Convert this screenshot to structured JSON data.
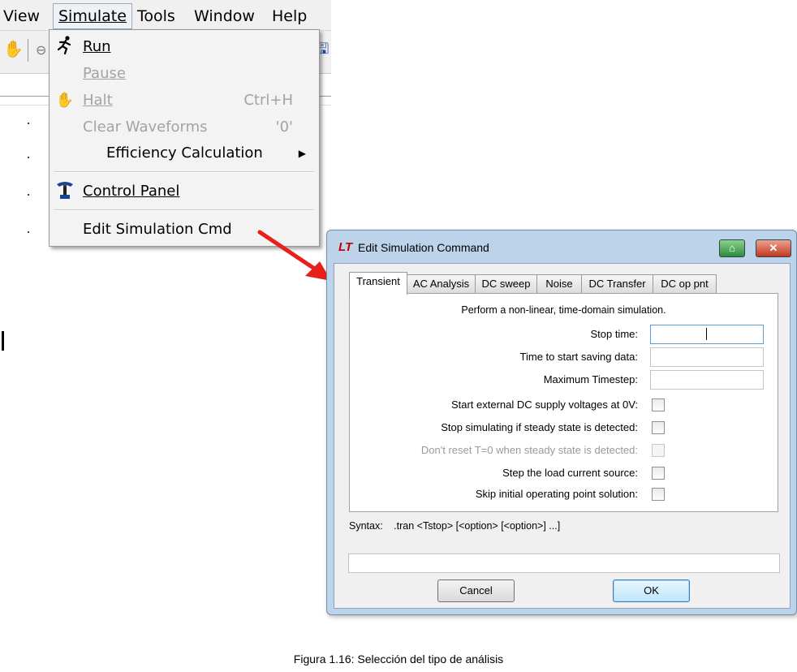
{
  "menubar": {
    "items": [
      {
        "label": "View"
      },
      {
        "label": "Simulate"
      },
      {
        "label": "Tools"
      },
      {
        "label": "Window"
      },
      {
        "label": "Help"
      }
    ]
  },
  "simulate_menu": {
    "run": {
      "label": "Run",
      "icon": "running-man-icon"
    },
    "pause": {
      "label": "Pause",
      "disabled": true
    },
    "halt": {
      "label": "Halt",
      "shortcut": "Ctrl+H",
      "icon": "hand-icon",
      "disabled": true
    },
    "clear_waveforms": {
      "label": "Clear Waveforms",
      "shortcut": "'0'",
      "disabled": true
    },
    "efficiency": {
      "label": "Efficiency Calculation",
      "submenu": true
    },
    "control_panel": {
      "label": "Control Panel",
      "icon": "control-panel-icon"
    },
    "edit_sim_cmd": {
      "label": "Edit Simulation Cmd"
    }
  },
  "dialog": {
    "logo": "LT",
    "title": "Edit Simulation Command",
    "tabs": [
      {
        "label": "Transient",
        "active": true
      },
      {
        "label": "AC Analysis"
      },
      {
        "label": "DC sweep"
      },
      {
        "label": "Noise"
      },
      {
        "label": "DC Transfer"
      },
      {
        "label": "DC op pnt"
      }
    ],
    "description": "Perform a non-linear, time-domain simulation.",
    "fields": {
      "stop_time": {
        "label": "Stop time:",
        "value": ""
      },
      "start_saving": {
        "label": "Time to start saving data:",
        "value": ""
      },
      "max_timestep": {
        "label": "Maximum Timestep:",
        "value": ""
      }
    },
    "checkboxes": {
      "start_dc_0v": {
        "label": "Start external DC supply voltages at 0V:",
        "checked": false
      },
      "stop_steady": {
        "label": "Stop simulating if steady state is detected:",
        "checked": false
      },
      "dont_reset": {
        "label": "Don't reset T=0 when steady state is detected:",
        "checked": false,
        "disabled": true
      },
      "step_load": {
        "label": "Step the load current source:",
        "checked": false
      },
      "skip_op": {
        "label": "Skip initial operating point solution:",
        "checked": false
      }
    },
    "syntax_label": "Syntax:",
    "syntax_text": ".tran <Tstop> [<option> [<option>] ...]",
    "command_line": "",
    "cancel_label": "Cancel",
    "ok_label": "OK"
  },
  "caption": "Figura 1.16: Selección del tipo de análisis",
  "colors": {
    "arrow": "#e8201c",
    "dialog_frame": "#bcd3ea",
    "disabled_text": "#a3a3a3"
  }
}
